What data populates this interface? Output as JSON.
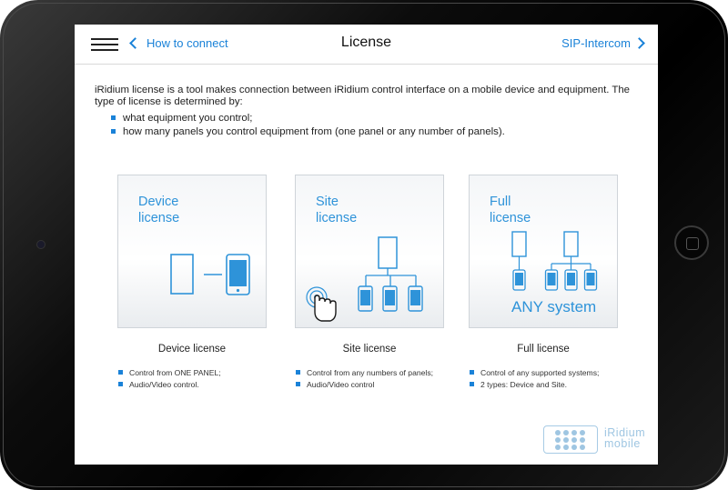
{
  "nav": {
    "back_label": "How to connect",
    "title": "License",
    "next_label": "SIP-Intercom"
  },
  "intro": {
    "text": "iRidium license is a tool makes connection between iRidium control interface on a mobile device and equipment. The type of license is determined by:",
    "bullets": [
      "what equipment you control;",
      "how many panels you control equipment from (one panel or any number of panels)."
    ]
  },
  "licenses": [
    {
      "card_title_line1": "Device",
      "card_title_line2": "license",
      "caption": "Device license",
      "bullets": [
        "Control from ONE PANEL;",
        "Audio/Video control."
      ]
    },
    {
      "card_title_line1": "Site",
      "card_title_line2": "license",
      "caption": "Site license",
      "bullets": [
        "Control from any numbers of panels;",
        "Audio/Video control"
      ]
    },
    {
      "card_title_line1": "Full",
      "card_title_line2": "license",
      "card_tagline": "ANY system",
      "caption": "Full license",
      "bullets": [
        "Control of any supported systems;",
        "2 types: Device and Site."
      ]
    }
  ],
  "logo": {
    "line1": "iRidium",
    "line2": "mobile"
  },
  "icons": {
    "menu": "hamburger-icon",
    "back": "chevron-left-icon",
    "next": "chevron-right-icon",
    "touch": "hand-touch-icon",
    "panel": "tablet-icon",
    "device": "smartphone-icon"
  },
  "colors": {
    "accent": "#1a82d8",
    "card_accent": "#2e93d9",
    "logo": "#9fc6e2"
  }
}
